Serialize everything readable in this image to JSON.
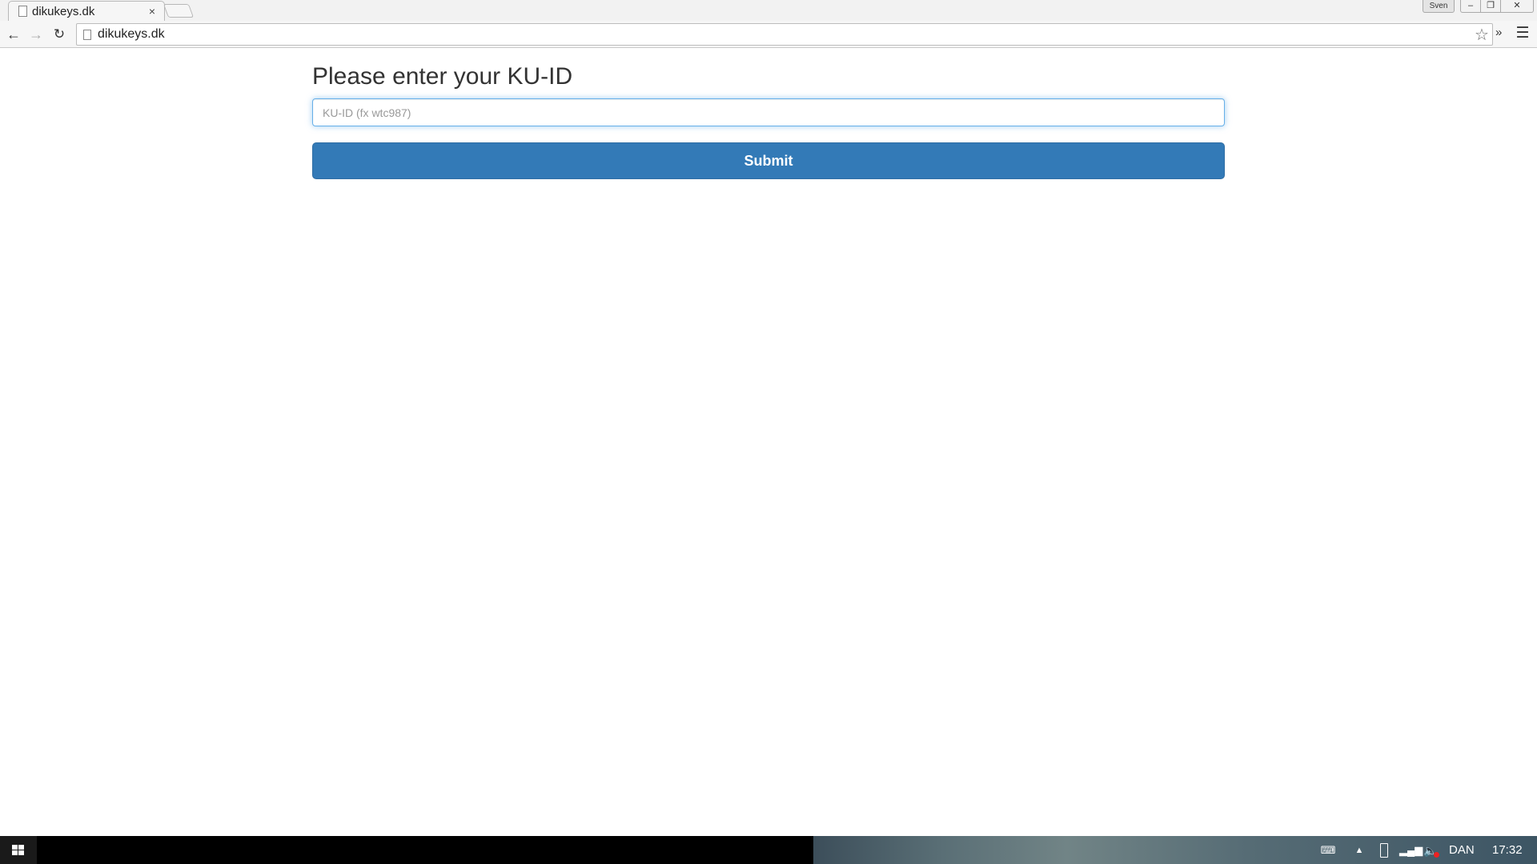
{
  "browser": {
    "tab_title": "dikukeys.dk",
    "tab_close": "×",
    "url": "dikukeys.dk",
    "profile_name": "Sven",
    "extensions_glyph": "»"
  },
  "page": {
    "heading": "Please enter your KU-ID",
    "input_placeholder": "KU-ID (fx wtc987)",
    "input_value": "",
    "submit_label": "Submit",
    "accent_color": "#337ab7"
  },
  "taskbar": {
    "language": "DAN",
    "clock": "17:32"
  },
  "icons": {
    "back": "arrow-left-icon",
    "forward": "arrow-right-icon",
    "reload": "reload-icon",
    "bookmark": "star-icon",
    "menu": "hamburger-menu-icon",
    "start": "windows-logo-icon"
  }
}
